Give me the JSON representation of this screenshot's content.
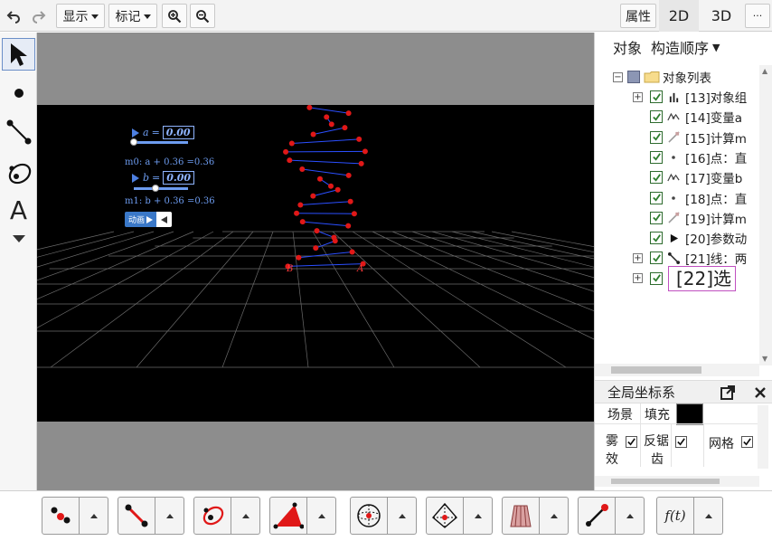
{
  "toolbar": {
    "display_label": "显示",
    "mark_label": "标记",
    "properties_label": "属性",
    "view_2d": "2D",
    "view_3d": "3D",
    "more_label": "···"
  },
  "left_tools": {
    "text_tool_label": "A"
  },
  "scene": {
    "slider_a_label": "a",
    "slider_a_value": "0.00",
    "measure_m0": "m0: a + 0.36 =0.36",
    "slider_b_label": "b",
    "slider_b_value": "0.00",
    "measure_m1": "m1: b + 0.36 =0.36",
    "animate_label": "动画",
    "point_b_label": "B",
    "point_a_label": "A",
    "slider_a_progress": 0,
    "slider_b_progress": 0.4
  },
  "right_panel": {
    "tab_objects": "对象",
    "tab_construct_order": "构造顺序",
    "tree_root": "对象列表",
    "items": [
      {
        "label": "[13]对象组",
        "icon": "bar-chart-icon",
        "expandable": true
      },
      {
        "label": "[14]变量a",
        "icon": "variable-icon",
        "expandable": false
      },
      {
        "label": "[15]计算m",
        "icon": "calculate-icon",
        "expandable": false
      },
      {
        "label": "[16]点：直",
        "icon": "point-icon",
        "expandable": false
      },
      {
        "label": "[17]变量b",
        "icon": "variable-icon",
        "expandable": false
      },
      {
        "label": "[18]点：直",
        "icon": "point-icon",
        "expandable": false
      },
      {
        "label": "[19]计算m",
        "icon": "calculate-icon",
        "expandable": false
      },
      {
        "label": "[20]参数动",
        "icon": "play-icon",
        "expandable": false
      },
      {
        "label": "[21]线：两",
        "icon": "segment-icon",
        "expandable": true
      },
      {
        "label": "[22]选",
        "icon": "",
        "expandable": true
      }
    ],
    "global_title": "全局坐标系",
    "scene_label": "场景",
    "fill_label": "填充",
    "fill_color": "#000000",
    "fog_label_1": "雾",
    "fog_label_2": "效",
    "antialias_label_1": "反锯",
    "antialias_label_2": "齿",
    "grid_label": "网格"
  },
  "bottom_tools": {
    "function_label": "f(t)"
  },
  "colors": {
    "accent": "#3a78c8",
    "helix_points": "#e01818",
    "helix_links": "#2b4fff"
  }
}
